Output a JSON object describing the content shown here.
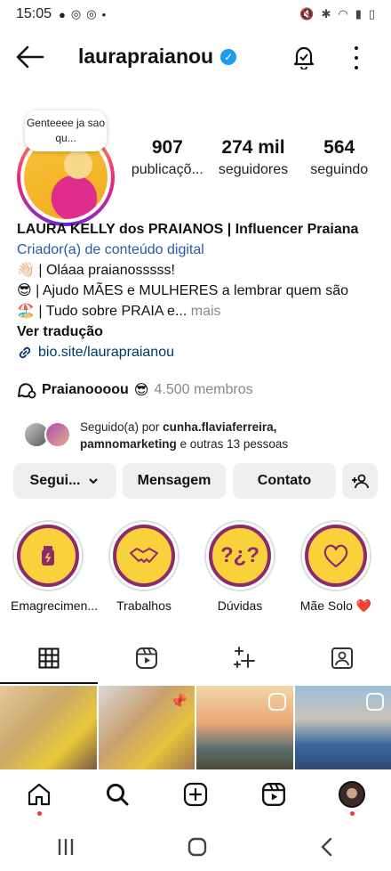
{
  "status_bar": {
    "time": "15:05"
  },
  "header": {
    "username": "laurapraianou"
  },
  "profile": {
    "note": "Genteeee ja sao qu...",
    "stats": [
      {
        "value": "907",
        "label": "publicaçõ..."
      },
      {
        "value": "274 mil",
        "label": "seguidores"
      },
      {
        "value": "564",
        "label": "seguindo"
      }
    ]
  },
  "bio": {
    "name": "LAURA KELLY dos PRAIANOS | Influencer Praiana",
    "category": "Criador(a) de conteúdo digital",
    "line1_emoji": "👋🏻",
    "line1": "| Oláaa praianosssss!",
    "line2_emoji": "😎",
    "line2": "| Ajudo MÃES e MULHERES a lembrar quem são",
    "line3_emoji": "🏖️",
    "line3": "| Tudo sobre PRAIA e...",
    "more": "mais",
    "translate": "Ver tradução",
    "link": "bio.site/laurapraianou"
  },
  "community": {
    "name": "Praianoooou",
    "emoji": "😎",
    "members": "4.500 membros"
  },
  "followed_by": {
    "prefix": "Seguido(a) por",
    "user1": "cunha.flaviaferreira,",
    "user2": "pamnomarketing",
    "suffix": "e outras 13 pessoas"
  },
  "buttons": {
    "following": "Segui...",
    "message": "Mensagem",
    "contact": "Contato"
  },
  "highlights": [
    {
      "label": "Emagrecimen..."
    },
    {
      "label": "Trabalhos"
    },
    {
      "label": "Dúvidas"
    },
    {
      "label": "Mãe Solo ❤️"
    }
  ],
  "colors": {
    "accent_blue": "#1d9bf0",
    "link_blue": "#00376b",
    "highlight_yellow": "#f9d23b",
    "highlight_purple": "#8b2a6e",
    "notification_red": "#ff3040"
  }
}
